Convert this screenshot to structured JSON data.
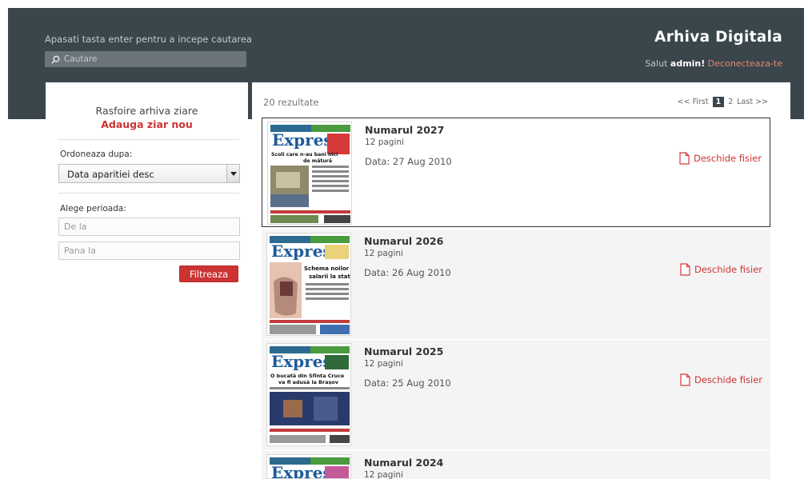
{
  "header": {
    "hint": "Apasati tasta enter pentru a incepe cautarea",
    "search_placeholder": "Cautare",
    "brand": "Arhiva Digitala",
    "greeting": "Salut",
    "user": "admin!",
    "logout": "Deconecteaza-te"
  },
  "sidebar": {
    "title": "Rasfoire arhiva ziare",
    "add_link": "Adauga ziar nou",
    "sort_label": "Ordoneaza dupa:",
    "sort_value": "Data aparitiei desc",
    "period_label": "Alege perioada:",
    "from_placeholder": "De la",
    "to_placeholder": "Pana la",
    "filter_button": "Filtreaza"
  },
  "results": {
    "count": "20 rezultate",
    "pagination": {
      "first": "<< First",
      "current": "1",
      "next": "2",
      "last": "Last >>"
    },
    "open_label": "Deschide fisier",
    "items": [
      {
        "title": "Numarul 2027",
        "pages": "12 pagini",
        "date": "Data: 27 Aug 2010",
        "masthead": "Expres",
        "headline": "Scoli care n-au bani nici de mătură"
      },
      {
        "title": "Numarul 2026",
        "pages": "12 pagini",
        "date": "Data: 26 Aug 2010",
        "masthead": "Expres",
        "headline": "Schema noilor salarii la stat"
      },
      {
        "title": "Numarul 2025",
        "pages": "12 pagini",
        "date": "Data: 25 Aug 2010",
        "masthead": "Expres",
        "headline": "O bucată din Sfînta Cruce va fi adusă la Brașov"
      },
      {
        "title": "Numarul 2024",
        "pages": "12 pagini",
        "date": "",
        "masthead": "Expres",
        "headline": ""
      }
    ]
  },
  "colors": {
    "header_bg": "#3a464c",
    "accent": "#cc3333",
    "link": "#e9856e",
    "row_bg": "#f4f4f4"
  }
}
